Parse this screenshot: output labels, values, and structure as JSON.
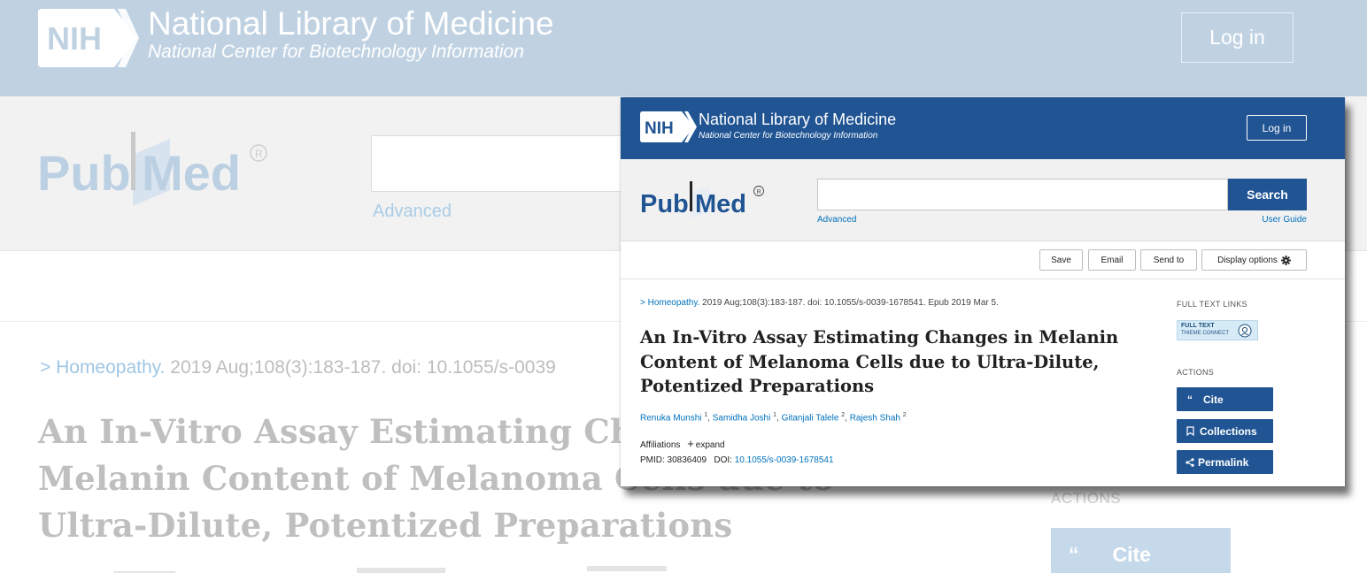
{
  "background": {
    "header": {
      "logo": "NIH",
      "title": "National Library of Medicine",
      "subtitle": "National Center for Biotechnology Information",
      "login_label": "Log in"
    },
    "search": {
      "logo": "PubMed",
      "value": "",
      "advanced_label": "Advanced"
    },
    "citation": {
      "journal": "> Homeopathy.",
      "rest": " 2019 Aug;108(3):183-187. doi: 10.1055/s-0039"
    },
    "title": "An In-Vitro Assay Estimating Changes in Melanin Content of Melanoma Cells due to Ultra-Dilute, Potentized Preparations",
    "sidebar": {
      "actions_label": "ACTIONS",
      "cite_label": "Cite"
    }
  },
  "window": {
    "header": {
      "logo": "NIH",
      "title": "National Library of Medicine",
      "subtitle": "National Center for Biotechnology Information",
      "login_label": "Log in"
    },
    "search": {
      "logo": "PubMed",
      "value": "",
      "button_label": "Search",
      "advanced_label": "Advanced",
      "user_guide_label": "User Guide"
    },
    "toolbar": {
      "save": "Save",
      "email": "Email",
      "send_to": "Send to",
      "display_options": "Display options"
    },
    "article": {
      "citation_journal": "> Homeopathy.",
      "citation_rest": " 2019 Aug;108(3):183-187. doi: 10.1055/s-0039-1678541. Epub 2019 Mar 5.",
      "title": "An In-Vitro Assay Estimating Changes in Melanin Content of Melanoma Cells due to Ultra-Dilute, Potentized Preparations",
      "authors": [
        {
          "name": "Renuka Munshi",
          "aff": "1"
        },
        {
          "name": "Samidha Joshi",
          "aff": "1"
        },
        {
          "name": "Gitanjali Talele",
          "aff": "2"
        },
        {
          "name": "Rajesh Shah",
          "aff": "2"
        }
      ],
      "affiliations_label": "Affiliations",
      "expand_label": "expand",
      "pmid_label": "PMID: 30836409",
      "doi_label": "DOI:",
      "doi_value": "10.1055/s-0039-1678541"
    },
    "sidebar": {
      "full_text_links_label": "FULL TEXT LINKS",
      "badge_line1": "FULL TEXT",
      "badge_line2": "THIEME CONNECT",
      "actions_label": "ACTIONS",
      "cite_label": "Cite",
      "collections_label": "Collections",
      "permalink_label": "Permalink"
    }
  },
  "colors": {
    "nih_blue": "#205493",
    "link_blue": "#0071bc",
    "faded_header": "#c0d2e2"
  }
}
